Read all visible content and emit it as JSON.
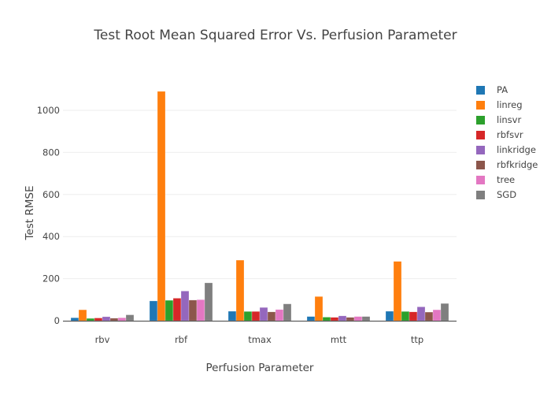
{
  "chart_data": {
    "type": "bar",
    "title": "Test Root Mean Squared Error Vs. Perfusion Parameter",
    "xlabel": "Perfusion Parameter",
    "ylabel": "Test RMSE",
    "ylim": [
      0,
      1100
    ],
    "yticks": [
      0,
      200,
      400,
      600,
      800,
      1000
    ],
    "grid": true,
    "legend_position": "top-right",
    "categories": [
      "rbv",
      "rbf",
      "tmax",
      "mtt",
      "ttp"
    ],
    "series": [
      {
        "name": "PA",
        "color": "#1f77b4",
        "values": [
          14,
          94,
          45,
          20,
          45
        ]
      },
      {
        "name": "linreg",
        "color": "#ff7f0e",
        "values": [
          52,
          1090,
          288,
          115,
          282
        ]
      },
      {
        "name": "linsvr",
        "color": "#2ca02c",
        "values": [
          11,
          97,
          44,
          17,
          44
        ]
      },
      {
        "name": "rbfsvr",
        "color": "#d62728",
        "values": [
          13,
          107,
          44,
          16,
          42
        ]
      },
      {
        "name": "linkridge",
        "color": "#9467bd",
        "values": [
          19,
          141,
          63,
          23,
          66
        ]
      },
      {
        "name": "rbfkridge",
        "color": "#8c564b",
        "values": [
          12,
          98,
          42,
          16,
          41
        ]
      },
      {
        "name": "tree",
        "color": "#e377c2",
        "values": [
          14,
          100,
          53,
          20,
          52
        ]
      },
      {
        "name": "SGD",
        "color": "#7f7f7f",
        "values": [
          28,
          180,
          80,
          20,
          82
        ]
      }
    ]
  }
}
